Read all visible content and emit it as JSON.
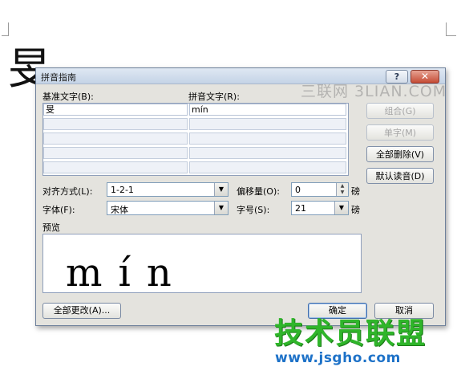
{
  "background": {
    "doc_char": "旻"
  },
  "dialog": {
    "title": "拼音指南",
    "help_label": "?",
    "close_label": "✕",
    "watermark": "三联网 3LIAN.COM",
    "base_text_label": "基准文字(B):",
    "ruby_text_label": "拼音文字(R):",
    "rows": [
      {
        "base": "旻",
        "ruby": "mín"
      },
      {
        "base": "",
        "ruby": ""
      },
      {
        "base": "",
        "ruby": ""
      },
      {
        "base": "",
        "ruby": ""
      },
      {
        "base": "",
        "ruby": ""
      }
    ],
    "buttons": {
      "group": "组合(G)",
      "mono": "单字(M)",
      "clear_all": "全部删除(V)",
      "default_reading": "默认读音(D)",
      "change_all": "全部更改(A)...",
      "ok": "确定",
      "cancel": "取消"
    },
    "alignment": {
      "label": "对齐方式(L):",
      "value": "1-2-1"
    },
    "offset": {
      "label": "偏移量(O):",
      "value": "0",
      "unit": "磅"
    },
    "font": {
      "label": "字体(F):",
      "value": "宋体"
    },
    "size": {
      "label": "字号(S):",
      "value": "21",
      "unit": "磅"
    },
    "preview_label": "预览",
    "preview_text": "mín"
  },
  "watermark_logo": {
    "brand": "技术员联盟",
    "url": "www.jsgho.com"
  },
  "colors": {
    "dialog_bg": "#e4e3de",
    "title_gradient": "#c4d3e6",
    "brand_green": "#2fb52a",
    "url_blue": "#1e72c8"
  }
}
